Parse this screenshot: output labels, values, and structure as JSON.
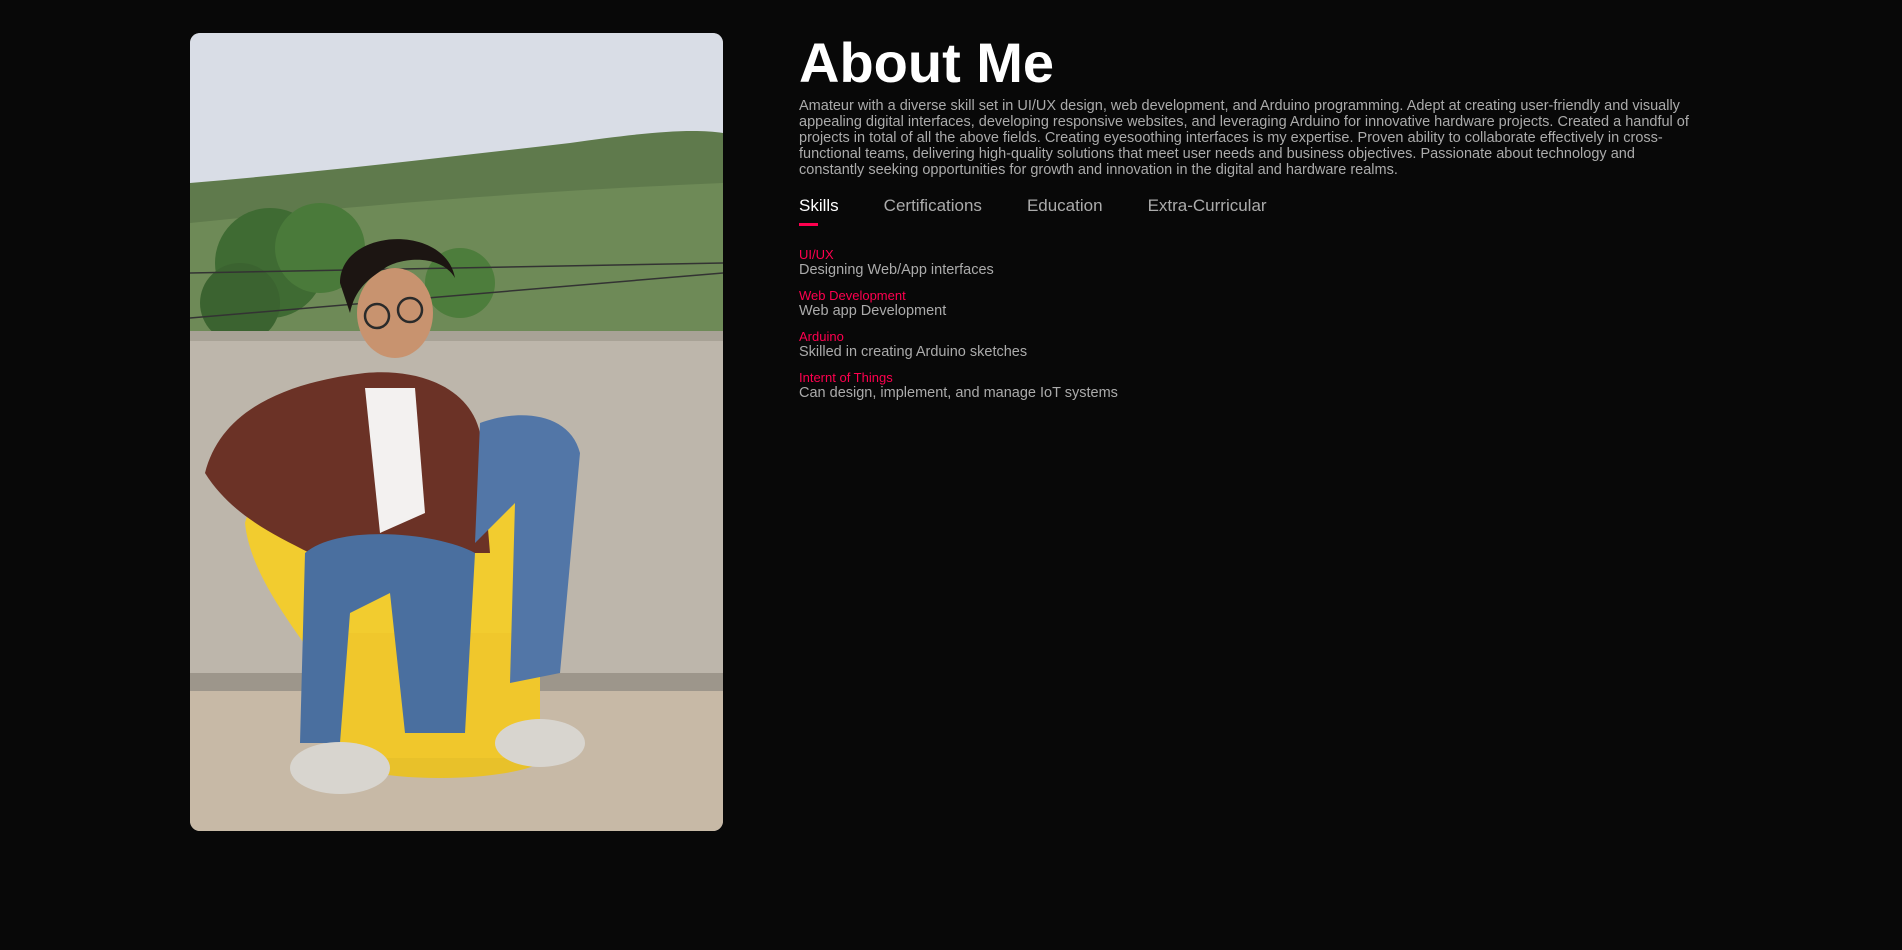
{
  "about": {
    "title": "About Me",
    "intro": "Amateur with a diverse skill set in UI/UX design, web development, and Arduino programming. Adept at creating user-friendly and visually appealing digital interfaces, developing responsive websites, and leveraging Arduino for innovative hardware projects. Created a handful of projects in total of all the above fields. Creating eyesoothing interfaces is my expertise. Proven ability to collaborate effectively in cross-functional teams, delivering high-quality solutions that meet user needs and business objectives. Passionate about technology and constantly seeking opportunities for growth and innovation in the digital and hardware realms."
  },
  "tabs": [
    {
      "label": "Skills",
      "active": true
    },
    {
      "label": "Certifications",
      "active": false
    },
    {
      "label": "Education",
      "active": false
    },
    {
      "label": "Extra-Curricular",
      "active": false
    }
  ],
  "skills": [
    {
      "name": "UI/UX",
      "desc": "Designing Web/App interfaces"
    },
    {
      "name": "Web Development",
      "desc": "Web app Development"
    },
    {
      "name": "Arduino",
      "desc": "Skilled in creating Arduino sketches"
    },
    {
      "name": "Internt of Things",
      "desc": "Can design, implement, and manage IoT systems"
    }
  ],
  "colors": {
    "background": "#080808",
    "accent": "#ff004f",
    "text": "#ababab",
    "heading": "#ffffff"
  }
}
